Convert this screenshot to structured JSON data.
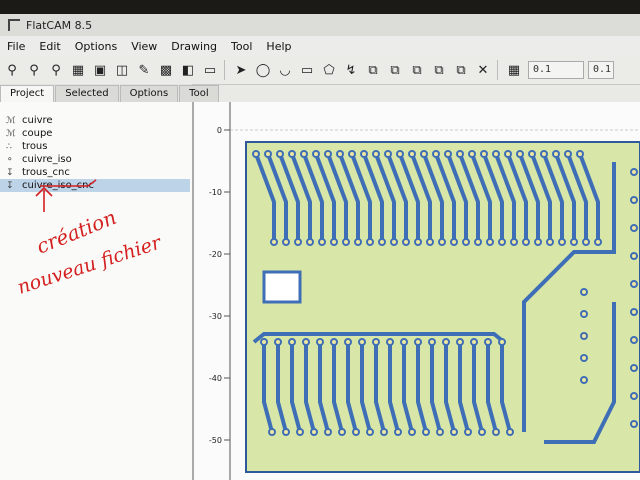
{
  "window": {
    "title": "FlatCAM 8.5"
  },
  "menu": [
    "File",
    "Edit",
    "Options",
    "View",
    "Drawing",
    "Tool",
    "Help"
  ],
  "toolbar": {
    "icons": [
      "zoom-fit-icon",
      "zoom-in-icon",
      "zoom-out-icon",
      "replot-icon",
      "clear-plot-icon",
      "new-geometry-icon",
      "edit-geometry-icon",
      "save-icon",
      "delete-icon",
      "shell-icon",
      "pointer-icon",
      "circle-icon",
      "arc-icon",
      "rectangle-icon",
      "polygon-icon",
      "path-icon",
      "union-icon",
      "intersection-icon",
      "subtract-icon",
      "copy-icon",
      "move-icon",
      "cut-icon",
      "grid-icon"
    ],
    "grid_x": "0.1",
    "grid_y": "0.1"
  },
  "tabs": [
    "Project",
    "Selected",
    "Options",
    "Tool"
  ],
  "project_items": [
    {
      "label": "cuivre",
      "icon": "gerber-icon"
    },
    {
      "label": "coupe",
      "icon": "gerber-icon"
    },
    {
      "label": "trous",
      "icon": "excellon-icon"
    },
    {
      "label": "cuivre_iso",
      "icon": "geometry-icon"
    },
    {
      "label": "trous_cnc",
      "icon": "cnc-icon"
    },
    {
      "label": "cuivre_iso_cnc",
      "icon": "cnc-icon"
    }
  ],
  "annotation": {
    "line1": "création",
    "line2": "nouveau fichier"
  },
  "plot": {
    "y_ticks": [
      "0",
      "-10",
      "-20",
      "-30",
      "-40",
      "-50"
    ],
    "board_color": "#d8e6a8",
    "trace_color": "#3e6fb6",
    "pad_color": "#f0e6a0"
  }
}
